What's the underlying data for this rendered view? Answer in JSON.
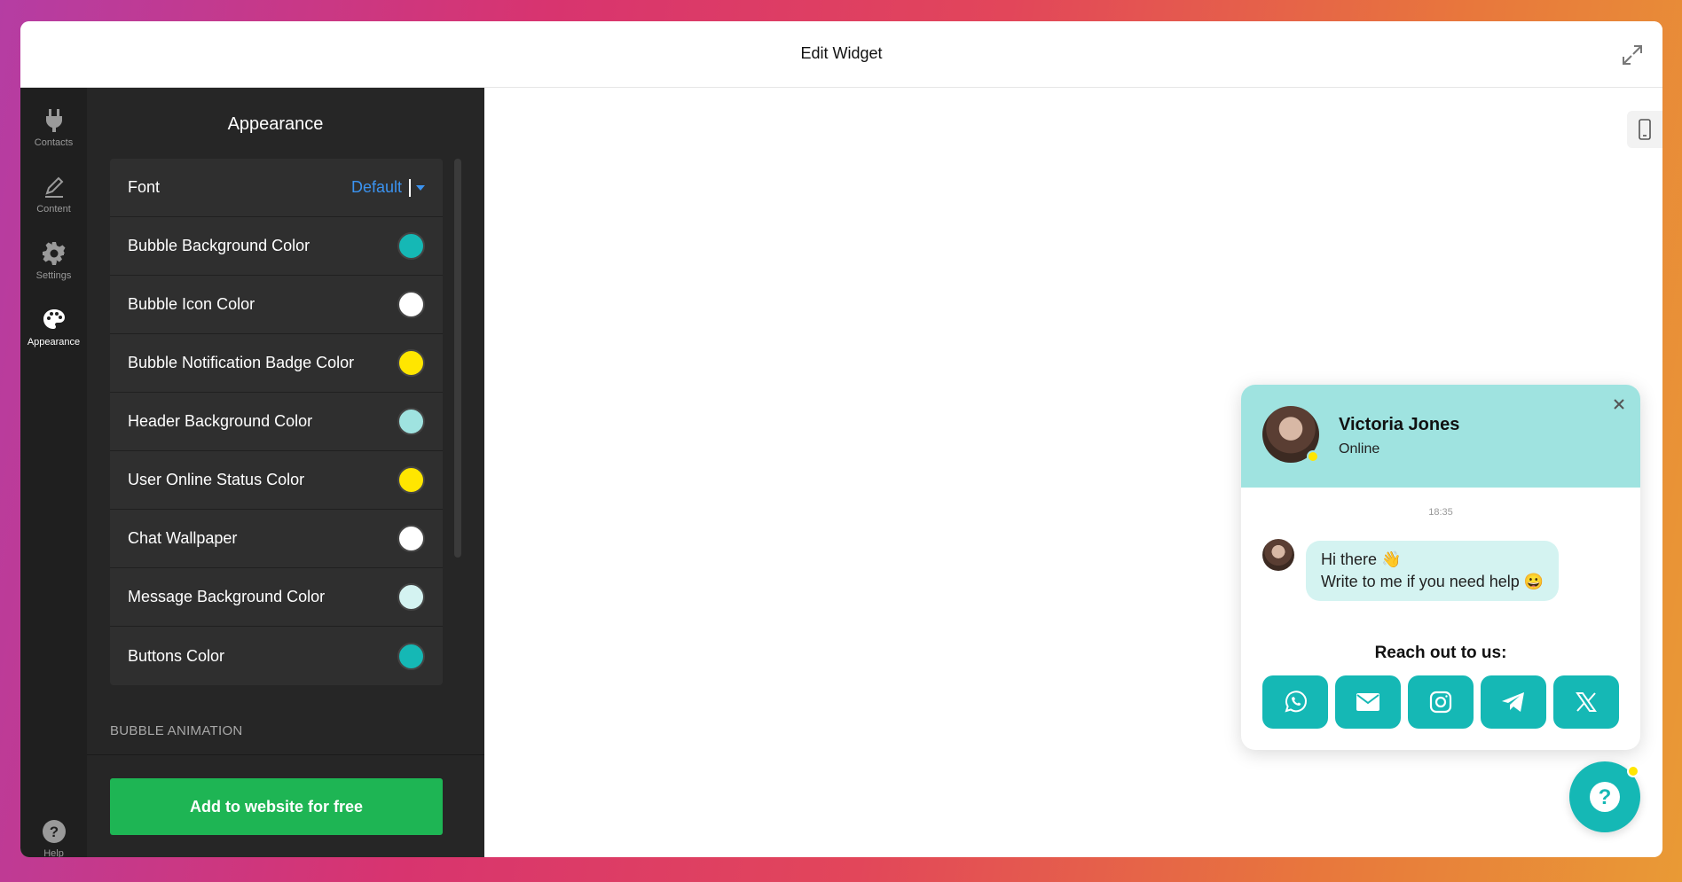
{
  "header": {
    "title": "Edit Widget"
  },
  "rail": {
    "items": [
      {
        "label": "Contacts",
        "icon": "plug-icon"
      },
      {
        "label": "Content",
        "icon": "pen-icon"
      },
      {
        "label": "Settings",
        "icon": "gear-icon"
      },
      {
        "label": "Appearance",
        "icon": "palette-icon",
        "active": true
      }
    ],
    "help_label": "Help"
  },
  "panel": {
    "title": "Appearance",
    "font": {
      "label": "Font",
      "value": "Default"
    },
    "colors": [
      {
        "label": "Bubble Background Color",
        "color": "#15b8b5"
      },
      {
        "label": "Bubble Icon Color",
        "color": "#ffffff"
      },
      {
        "label": "Bubble Notification Badge Color",
        "color": "#ffe600"
      },
      {
        "label": "Header Background Color",
        "color": "#9fe3e0"
      },
      {
        "label": "User Online Status Color",
        "color": "#ffe600"
      },
      {
        "label": "Chat Wallpaper",
        "color": "#ffffff"
      },
      {
        "label": "Message Background Color",
        "color": "#d4f3f1"
      },
      {
        "label": "Buttons Color",
        "color": "#15b8b5"
      }
    ],
    "section_label": "BUBBLE ANIMATION",
    "add_button": "Add to website for free"
  },
  "chat": {
    "agent_name": "Victoria Jones",
    "agent_status": "Online",
    "time": "18:35",
    "message_line1": "Hi there 👋",
    "message_line2": "Write to me if you need help 😀",
    "reach_label": "Reach out to us:",
    "channels": [
      "whatsapp-icon",
      "mail-icon",
      "instagram-icon",
      "telegram-icon",
      "x-icon"
    ]
  }
}
